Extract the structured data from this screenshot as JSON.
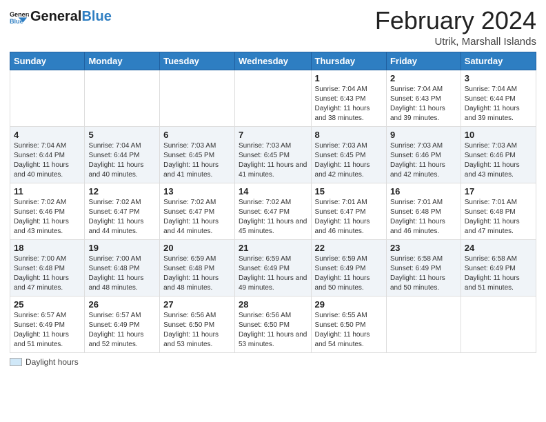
{
  "header": {
    "logo_general": "General",
    "logo_blue": "Blue",
    "month_title": "February 2024",
    "location": "Utrik, Marshall Islands"
  },
  "days_of_week": [
    "Sunday",
    "Monday",
    "Tuesday",
    "Wednesday",
    "Thursday",
    "Friday",
    "Saturday"
  ],
  "weeks": [
    [
      {
        "day": "",
        "sunrise": "",
        "sunset": "",
        "daylight": ""
      },
      {
        "day": "",
        "sunrise": "",
        "sunset": "",
        "daylight": ""
      },
      {
        "day": "",
        "sunrise": "",
        "sunset": "",
        "daylight": ""
      },
      {
        "day": "",
        "sunrise": "",
        "sunset": "",
        "daylight": ""
      },
      {
        "day": "1",
        "sunrise": "Sunrise: 7:04 AM",
        "sunset": "Sunset: 6:43 PM",
        "daylight": "Daylight: 11 hours and 38 minutes."
      },
      {
        "day": "2",
        "sunrise": "Sunrise: 7:04 AM",
        "sunset": "Sunset: 6:43 PM",
        "daylight": "Daylight: 11 hours and 39 minutes."
      },
      {
        "day": "3",
        "sunrise": "Sunrise: 7:04 AM",
        "sunset": "Sunset: 6:44 PM",
        "daylight": "Daylight: 11 hours and 39 minutes."
      }
    ],
    [
      {
        "day": "4",
        "sunrise": "Sunrise: 7:04 AM",
        "sunset": "Sunset: 6:44 PM",
        "daylight": "Daylight: 11 hours and 40 minutes."
      },
      {
        "day": "5",
        "sunrise": "Sunrise: 7:04 AM",
        "sunset": "Sunset: 6:44 PM",
        "daylight": "Daylight: 11 hours and 40 minutes."
      },
      {
        "day": "6",
        "sunrise": "Sunrise: 7:03 AM",
        "sunset": "Sunset: 6:45 PM",
        "daylight": "Daylight: 11 hours and 41 minutes."
      },
      {
        "day": "7",
        "sunrise": "Sunrise: 7:03 AM",
        "sunset": "Sunset: 6:45 PM",
        "daylight": "Daylight: 11 hours and 41 minutes."
      },
      {
        "day": "8",
        "sunrise": "Sunrise: 7:03 AM",
        "sunset": "Sunset: 6:45 PM",
        "daylight": "Daylight: 11 hours and 42 minutes."
      },
      {
        "day": "9",
        "sunrise": "Sunrise: 7:03 AM",
        "sunset": "Sunset: 6:46 PM",
        "daylight": "Daylight: 11 hours and 42 minutes."
      },
      {
        "day": "10",
        "sunrise": "Sunrise: 7:03 AM",
        "sunset": "Sunset: 6:46 PM",
        "daylight": "Daylight: 11 hours and 43 minutes."
      }
    ],
    [
      {
        "day": "11",
        "sunrise": "Sunrise: 7:02 AM",
        "sunset": "Sunset: 6:46 PM",
        "daylight": "Daylight: 11 hours and 43 minutes."
      },
      {
        "day": "12",
        "sunrise": "Sunrise: 7:02 AM",
        "sunset": "Sunset: 6:47 PM",
        "daylight": "Daylight: 11 hours and 44 minutes."
      },
      {
        "day": "13",
        "sunrise": "Sunrise: 7:02 AM",
        "sunset": "Sunset: 6:47 PM",
        "daylight": "Daylight: 11 hours and 44 minutes."
      },
      {
        "day": "14",
        "sunrise": "Sunrise: 7:02 AM",
        "sunset": "Sunset: 6:47 PM",
        "daylight": "Daylight: 11 hours and 45 minutes."
      },
      {
        "day": "15",
        "sunrise": "Sunrise: 7:01 AM",
        "sunset": "Sunset: 6:47 PM",
        "daylight": "Daylight: 11 hours and 46 minutes."
      },
      {
        "day": "16",
        "sunrise": "Sunrise: 7:01 AM",
        "sunset": "Sunset: 6:48 PM",
        "daylight": "Daylight: 11 hours and 46 minutes."
      },
      {
        "day": "17",
        "sunrise": "Sunrise: 7:01 AM",
        "sunset": "Sunset: 6:48 PM",
        "daylight": "Daylight: 11 hours and 47 minutes."
      }
    ],
    [
      {
        "day": "18",
        "sunrise": "Sunrise: 7:00 AM",
        "sunset": "Sunset: 6:48 PM",
        "daylight": "Daylight: 11 hours and 47 minutes."
      },
      {
        "day": "19",
        "sunrise": "Sunrise: 7:00 AM",
        "sunset": "Sunset: 6:48 PM",
        "daylight": "Daylight: 11 hours and 48 minutes."
      },
      {
        "day": "20",
        "sunrise": "Sunrise: 6:59 AM",
        "sunset": "Sunset: 6:48 PM",
        "daylight": "Daylight: 11 hours and 48 minutes."
      },
      {
        "day": "21",
        "sunrise": "Sunrise: 6:59 AM",
        "sunset": "Sunset: 6:49 PM",
        "daylight": "Daylight: 11 hours and 49 minutes."
      },
      {
        "day": "22",
        "sunrise": "Sunrise: 6:59 AM",
        "sunset": "Sunset: 6:49 PM",
        "daylight": "Daylight: 11 hours and 50 minutes."
      },
      {
        "day": "23",
        "sunrise": "Sunrise: 6:58 AM",
        "sunset": "Sunset: 6:49 PM",
        "daylight": "Daylight: 11 hours and 50 minutes."
      },
      {
        "day": "24",
        "sunrise": "Sunrise: 6:58 AM",
        "sunset": "Sunset: 6:49 PM",
        "daylight": "Daylight: 11 hours and 51 minutes."
      }
    ],
    [
      {
        "day": "25",
        "sunrise": "Sunrise: 6:57 AM",
        "sunset": "Sunset: 6:49 PM",
        "daylight": "Daylight: 11 hours and 51 minutes."
      },
      {
        "day": "26",
        "sunrise": "Sunrise: 6:57 AM",
        "sunset": "Sunset: 6:49 PM",
        "daylight": "Daylight: 11 hours and 52 minutes."
      },
      {
        "day": "27",
        "sunrise": "Sunrise: 6:56 AM",
        "sunset": "Sunset: 6:50 PM",
        "daylight": "Daylight: 11 hours and 53 minutes."
      },
      {
        "day": "28",
        "sunrise": "Sunrise: 6:56 AM",
        "sunset": "Sunset: 6:50 PM",
        "daylight": "Daylight: 11 hours and 53 minutes."
      },
      {
        "day": "29",
        "sunrise": "Sunrise: 6:55 AM",
        "sunset": "Sunset: 6:50 PM",
        "daylight": "Daylight: 11 hours and 54 minutes."
      },
      {
        "day": "",
        "sunrise": "",
        "sunset": "",
        "daylight": ""
      },
      {
        "day": "",
        "sunrise": "",
        "sunset": "",
        "daylight": ""
      }
    ]
  ],
  "footer": {
    "daylight_label": "Daylight hours"
  }
}
